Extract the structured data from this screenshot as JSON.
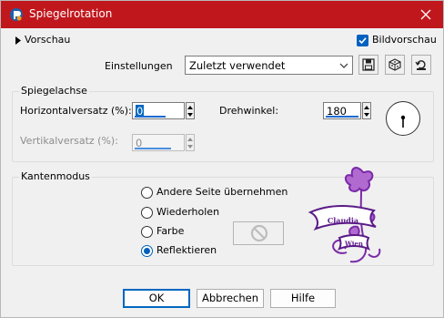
{
  "window": {
    "title": "Spiegelrotation"
  },
  "header": {
    "preview_label": "Vorschau",
    "bildvorschau_label": "Bildvorschau",
    "bildvorschau_checked": true,
    "settings_label": "Einstellungen",
    "settings_value": "Zuletzt verwendet"
  },
  "mirror_axis": {
    "group_label": "Spiegelachse",
    "horizontal_offset_label": "Horizontalversatz (%):",
    "horizontal_offset_value": "0",
    "rotation_label": "Drehwinkel:",
    "rotation_value": "180",
    "vertical_offset_label": "Vertikalversatz (%):",
    "vertical_offset_value": "0"
  },
  "edge_mode": {
    "group_label": "Kantenmodus",
    "options": [
      {
        "label": "Andere Seite übernehmen",
        "checked": false
      },
      {
        "label": "Wiederholen",
        "checked": false
      },
      {
        "label": "Farbe",
        "checked": false
      },
      {
        "label": "Reflektieren",
        "checked": true
      }
    ]
  },
  "watermark": {
    "line1": "Claudia",
    "line2": "Wien"
  },
  "buttons": {
    "ok": "OK",
    "cancel": "Abbrechen",
    "help": "Hilfe"
  },
  "colors": {
    "titlebar": "#c0171d",
    "accent": "#0060c0",
    "watermark": "#7a2aa8"
  }
}
